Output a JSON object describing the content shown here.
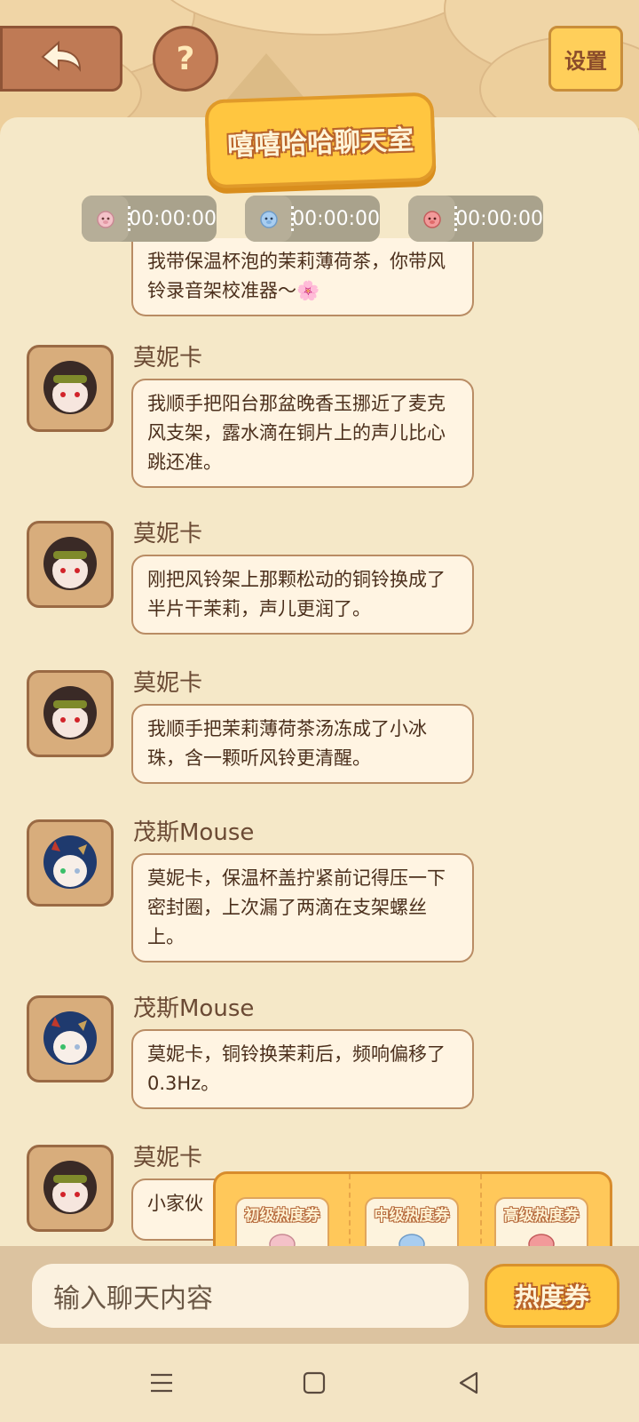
{
  "header": {
    "back_icon": "back-arrow-icon",
    "help_label": "?",
    "settings_label": "设置",
    "title": "嘻嘻哈哈聊天室"
  },
  "timers": [
    {
      "icon": "pig-icon-pink",
      "value": "00:00:00"
    },
    {
      "icon": "pig-icon-blue",
      "value": "00:00:00"
    },
    {
      "icon": "pig-icon-red",
      "value": "00:00:00"
    }
  ],
  "messages": [
    {
      "name": "",
      "text": "我带保温杯泡的茉莉薄荷茶，你带风铃录音架校准器～🌸",
      "avatar": ""
    },
    {
      "name": "莫妮卡",
      "text": "我顺手把阳台那盆晚香玉挪近了麦克风支架，露水滴在铜片上的声儿比心跳还准。",
      "avatar": "monica"
    },
    {
      "name": "莫妮卡",
      "text": "刚把风铃架上那颗松动的铜铃换成了半片干茉莉，声儿更润了。",
      "avatar": "monica"
    },
    {
      "name": "莫妮卡",
      "text": "我顺手把茉莉薄荷茶汤冻成了小冰珠，含一颗听风铃更清醒。",
      "avatar": "monica"
    },
    {
      "name": "茂斯Mouse",
      "text": "莫妮卡，保温杯盖拧紧前记得压一下密封圈，上次漏了两滴在支架螺丝上。",
      "avatar": "mouse"
    },
    {
      "name": "茂斯Mouse",
      "text": "莫妮卡，铜铃换茉莉后，频响偏移了0.3Hz。",
      "avatar": "mouse"
    },
    {
      "name": "莫妮卡",
      "text": "小家伙",
      "avatar": "monica"
    }
  ],
  "tickets": [
    {
      "label": "初级热度券",
      "icon": "pig-icon-pink"
    },
    {
      "label": "中级热度券",
      "icon": "pig-icon-blue"
    },
    {
      "label": "高级热度券",
      "icon": "pig-icon-red"
    }
  ],
  "input": {
    "placeholder": "输入聊天内容",
    "heat_button": "热度券"
  },
  "nav": {
    "menu_icon": "menu-icon",
    "home_icon": "home-square-icon",
    "back_icon": "back-triangle-icon"
  },
  "colors": {
    "accent": "#ffc640",
    "bubble_bg": "#fff4e2",
    "panel_bg": "#f5e8c8",
    "brown": "#8f5436"
  }
}
